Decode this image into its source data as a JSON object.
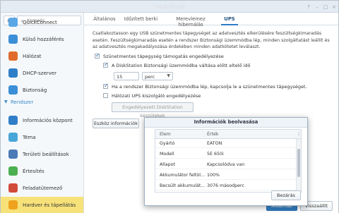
{
  "window": {
    "title": "Vezérlőpult"
  },
  "sidebar": {
    "search_placeholder": "Keresés",
    "items_top": [
      {
        "label": "QuickConnect",
        "icon": "quickconnect-icon",
        "color": "#5aa7e6"
      },
      {
        "label": "Külső hozzáférés",
        "icon": "globe-icon",
        "color": "#3b8fd6"
      },
      {
        "label": "Hálózat",
        "icon": "network-icon",
        "color": "#e06b2c"
      },
      {
        "label": "DHCP-szerver",
        "icon": "dhcp-icon",
        "color": "#2f7fc8"
      },
      {
        "label": "Biztonság",
        "icon": "shield-icon",
        "color": "#3b8fd6"
      }
    ],
    "section": "Rendszer",
    "items_system": [
      {
        "label": "Információs központ",
        "icon": "info-icon",
        "color": "#2f7fc8"
      },
      {
        "label": "Téma",
        "icon": "palette-icon",
        "color": "#49a6d8"
      },
      {
        "label": "Területi beállítások",
        "icon": "regional-icon",
        "color": "#4a7bb7"
      },
      {
        "label": "Értesítés",
        "icon": "notification-icon",
        "color": "#4bb050"
      },
      {
        "label": "Feladatütemező",
        "icon": "calendar-icon",
        "color": "#d24a3a"
      },
      {
        "label": "Hardver és tápellátás",
        "icon": "bulb-icon",
        "color": "#f0a21e"
      }
    ]
  },
  "tabs": [
    "Általános",
    "Időzített berki",
    "Merevlemez hibernálás",
    "UPS"
  ],
  "ups": {
    "description": "Csatlakoztasson egy USB szünetmentes tápegységet az adatvesztés elkerülésére feszültségkimaradás esetén. Feszültségkimaradás esetén a rendszer Biztonsági üzemmódba lép, minden szolgáltatást leállít és az adatvesztés megakadályozása érdekében minden adatkötetet leválaszt.",
    "enable_label": "Szünetmentes tápegység támogatás engedélyezése",
    "safe_mode_label": "A DiskStation Biztonsági üzemmódba váltása előtt eltelő idő",
    "time_value": "15",
    "time_unit": "perc",
    "poweroff_label": "Ha a rendszer Biztonsági üzemmódba lép, kapcsolja le a szünetmentes tápegységet.",
    "network_label": "Hálózati UPS kiszolgáló engedélyezése",
    "allowed_button": "Engedélyezett DiskStation készülékek",
    "device_info_button": "Eszköz információk"
  },
  "dialog": {
    "title": "Információk beolvasása",
    "columns": [
      "Elem",
      "Érték"
    ],
    "rows": [
      [
        "Gyártó",
        "EATON"
      ],
      [
        "Modell",
        "5E 650i"
      ],
      [
        "Állapot",
        "Kapcsolódva van"
      ],
      [
        "Akkumulátor feltöl...",
        "100%"
      ],
      [
        "Becsült akkumulát...",
        "3076 másodperc"
      ]
    ],
    "close_button": "Bezárás"
  },
  "footer": {
    "apply": "Alkalmaz",
    "reset": "Visszaállít"
  }
}
